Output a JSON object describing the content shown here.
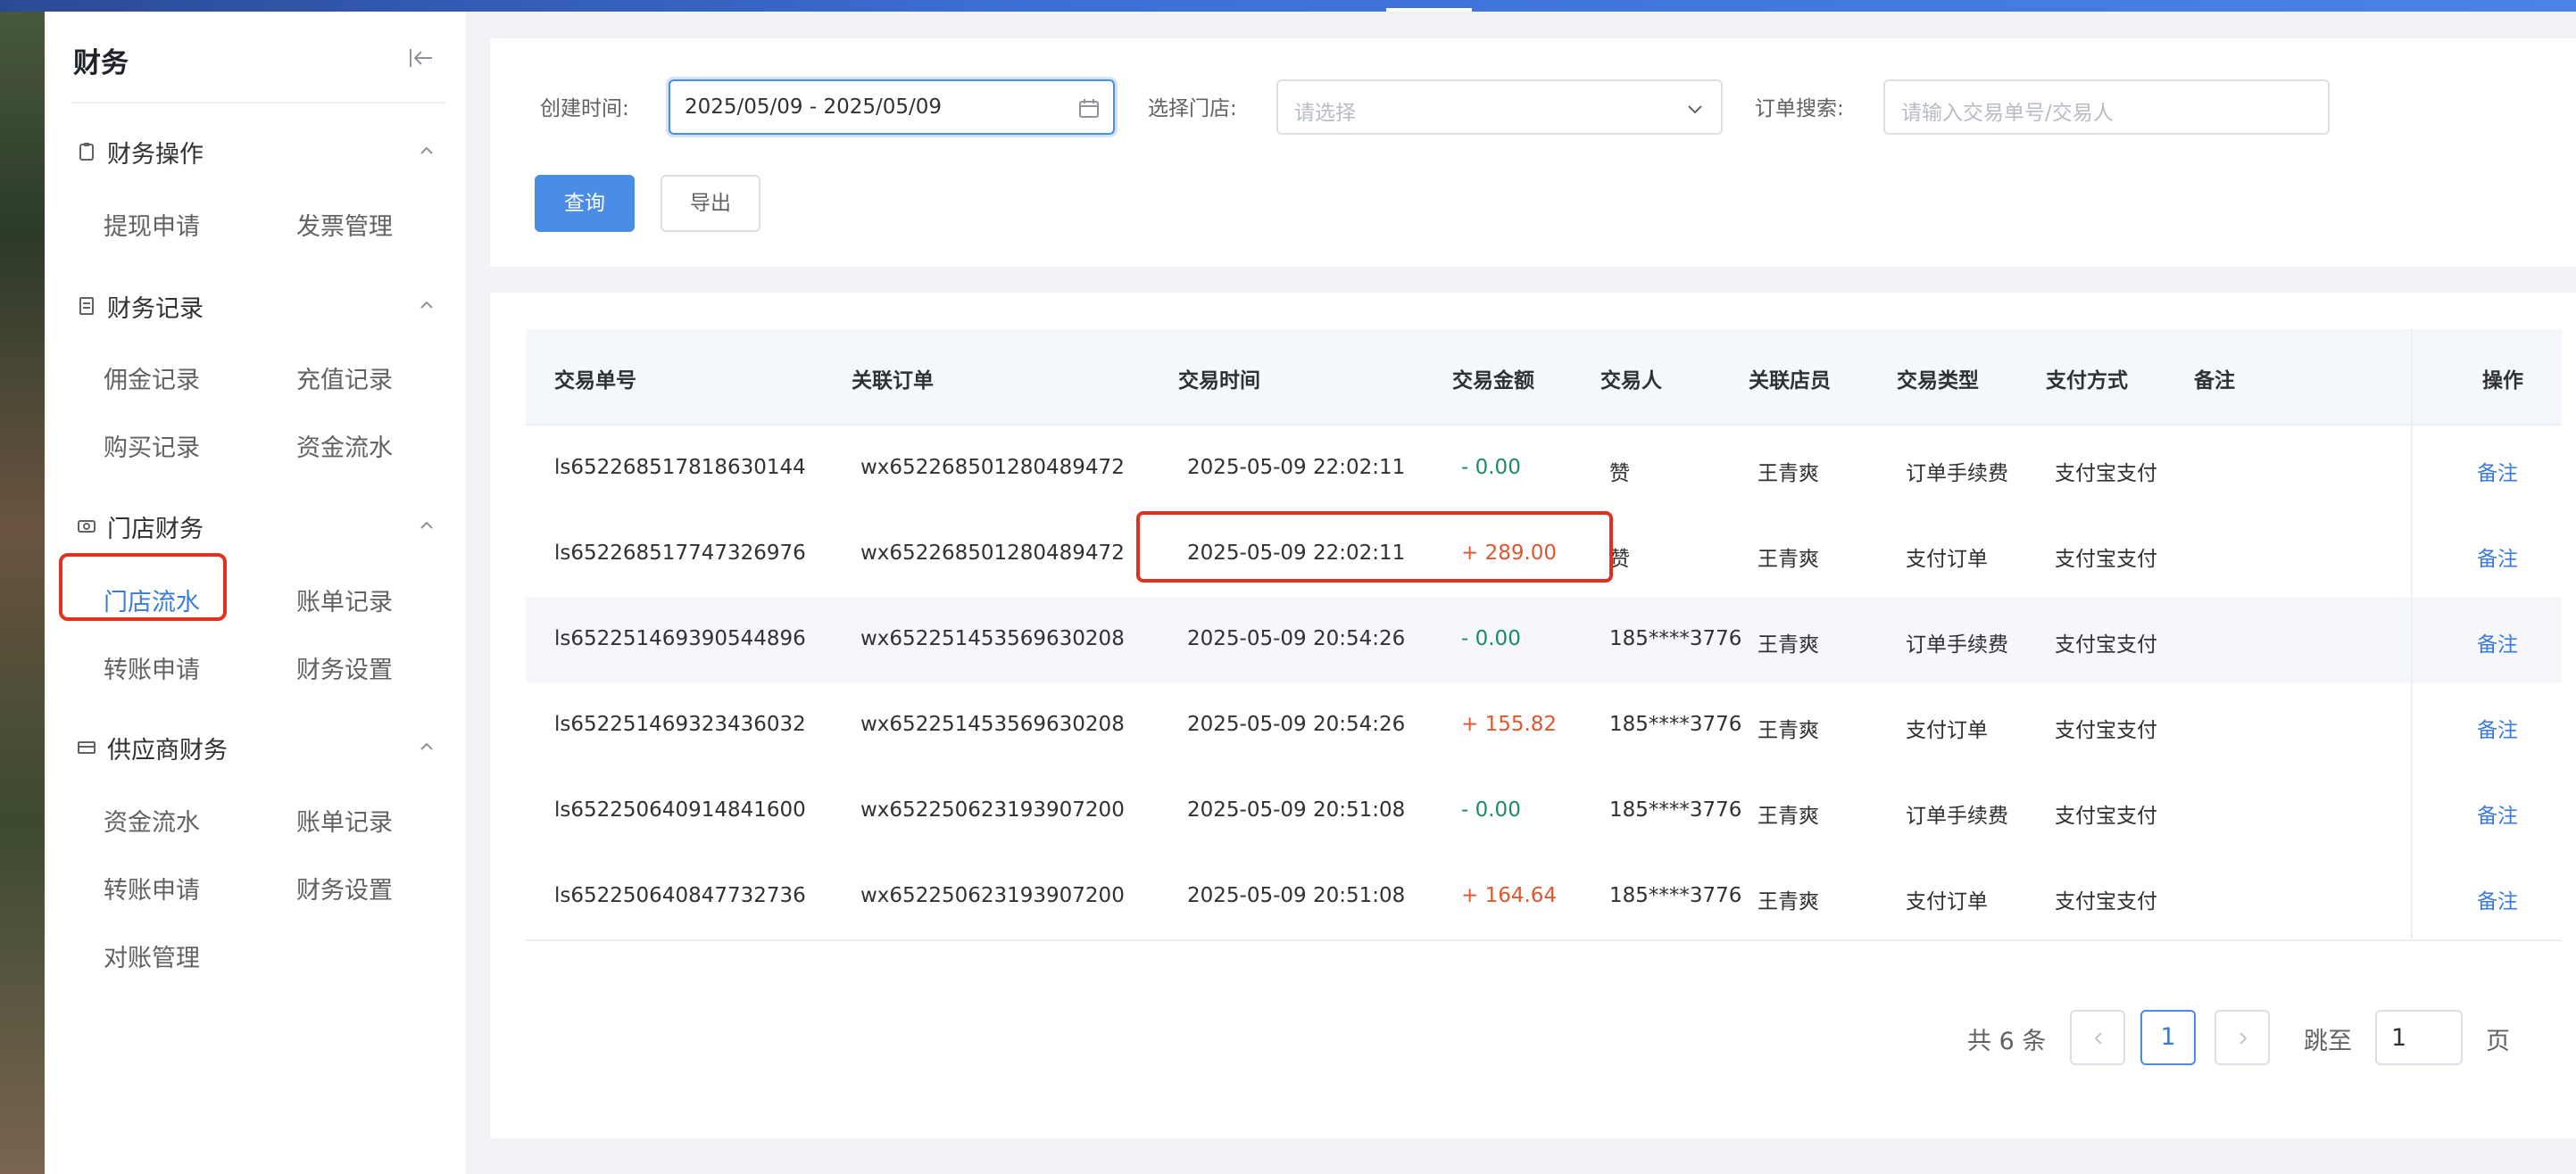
{
  "sidebar": {
    "title": "财务",
    "groups": [
      {
        "label": "财务操作",
        "icon": "clipboard-icon",
        "items": [
          "提现申请",
          "发票管理"
        ]
      },
      {
        "label": "财务记录",
        "icon": "document-icon",
        "items": [
          "佣金记录",
          "充值记录",
          "购买记录",
          "资金流水"
        ]
      },
      {
        "label": "门店财务",
        "icon": "cash-icon",
        "items": [
          "门店流水",
          "账单记录",
          "转账申请",
          "财务设置"
        ]
      },
      {
        "label": "供应商财务",
        "icon": "card-icon",
        "items": [
          "资金流水",
          "账单记录",
          "转账申请",
          "财务设置",
          "对账管理"
        ]
      }
    ],
    "active_item": "门店流水"
  },
  "filters": {
    "created_time_label": "创建时间:",
    "created_time_value": "2025/05/09 - 2025/05/09",
    "store_label": "选择门店:",
    "store_placeholder": "请选择",
    "order_search_label": "订单搜索:",
    "order_search_placeholder": "请输入交易单号/交易人",
    "query_button": "查询",
    "export_button": "导出"
  },
  "table": {
    "columns": [
      "交易单号",
      "关联订单",
      "交易时间",
      "交易金额",
      "交易人",
      "关联店员",
      "交易类型",
      "支付方式",
      "备注",
      "操作"
    ],
    "rows": [
      {
        "id": "ls652268517818630144",
        "order": "wx652268501280489472",
        "time": "2025-05-09 22:02:11",
        "amount": "- 0.00",
        "sign": "neg",
        "person": "赞",
        "clerk": "王青爽",
        "type": "订单手续费",
        "pay": "支付宝支付",
        "note": "",
        "op": "备注"
      },
      {
        "id": "ls652268517747326976",
        "order": "wx652268501280489472",
        "time": "2025-05-09 22:02:11",
        "amount": "+ 289.00",
        "sign": "pos",
        "person": "赞",
        "clerk": "王青爽",
        "type": "支付订单",
        "pay": "支付宝支付",
        "note": "",
        "op": "备注"
      },
      {
        "id": "ls652251469390544896",
        "order": "wx652251453569630208",
        "time": "2025-05-09 20:54:26",
        "amount": "- 0.00",
        "sign": "neg",
        "person": "185****3776",
        "clerk": "王青爽",
        "type": "订单手续费",
        "pay": "支付宝支付",
        "note": "",
        "op": "备注"
      },
      {
        "id": "ls652251469323436032",
        "order": "wx652251453569630208",
        "time": "2025-05-09 20:54:26",
        "amount": "+ 155.82",
        "sign": "pos",
        "person": "185****3776",
        "clerk": "王青爽",
        "type": "支付订单",
        "pay": "支付宝支付",
        "note": "",
        "op": "备注"
      },
      {
        "id": "ls652250640914841600",
        "order": "wx652250623193907200",
        "time": "2025-05-09 20:51:08",
        "amount": "- 0.00",
        "sign": "neg",
        "person": "185****3776",
        "clerk": "王青爽",
        "type": "订单手续费",
        "pay": "支付宝支付",
        "note": "",
        "op": "备注"
      },
      {
        "id": "ls652250640847732736",
        "order": "wx652250623193907200",
        "time": "2025-05-09 20:51:08",
        "amount": "+ 164.64",
        "sign": "pos",
        "person": "185****3776",
        "clerk": "王青爽",
        "type": "支付订单",
        "pay": "支付宝支付",
        "note": "",
        "op": "备注"
      }
    ]
  },
  "pagination": {
    "total": "共 6 条",
    "current": "1",
    "jump_label": "跳至",
    "jump_value": "1",
    "page_suffix": "页"
  },
  "colors": {
    "accent": "#4a8ce6",
    "negative_amount": "#1d8a6a",
    "positive_amount": "#e0562e",
    "highlight_box": "#e0301e"
  }
}
